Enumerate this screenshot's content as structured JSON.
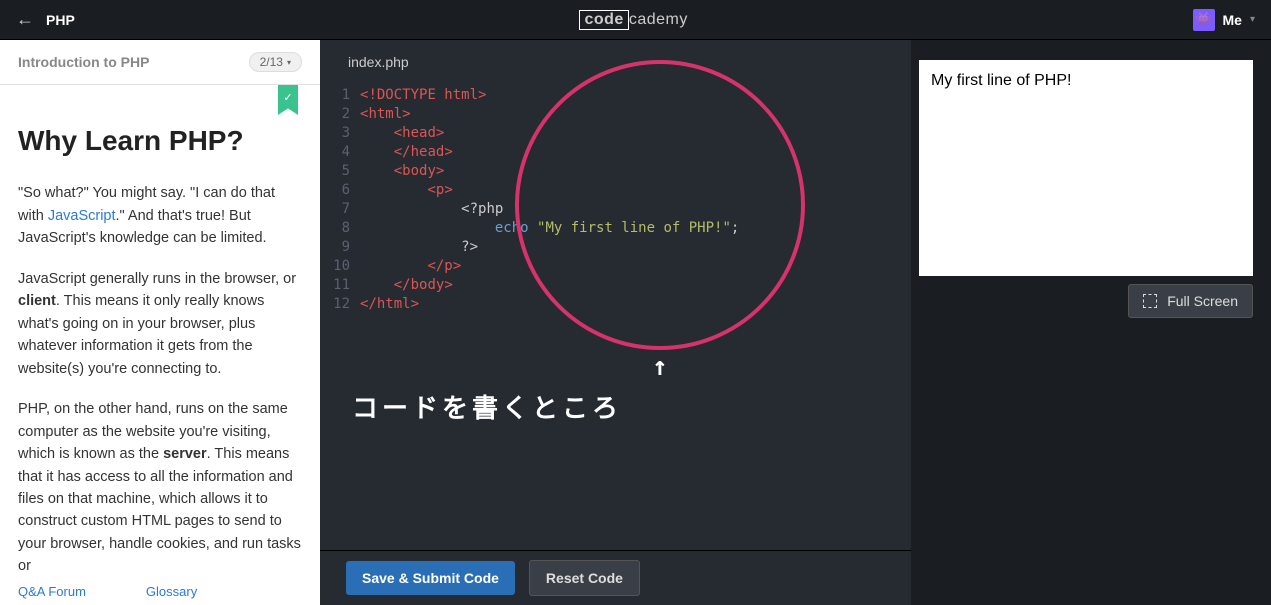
{
  "topbar": {
    "title": "PHP",
    "logo_boxed": "code",
    "logo_rest": "cademy",
    "me_label": "Me"
  },
  "sidebar": {
    "section_title": "Introduction to PHP",
    "progress": "2/13",
    "ribbon_check": "✓",
    "heading": "Why Learn PHP?",
    "para1_a": "\"So what?\" You might say. \"I can do that with ",
    "para1_link": "JavaScript",
    "para1_b": ".\" And that's true! But JavaScript's knowledge can be limited.",
    "para2_a": "JavaScript generally runs in the browser, or ",
    "para2_strong": "client",
    "para2_b": ". This means it only really knows what's going on in your browser, plus whatever information it gets from the website(s) you're connecting to.",
    "para3_a": "PHP, on the other hand, runs on the same computer as the website you're visiting, which is known as the ",
    "para3_strong": "server",
    "para3_b": ". This means that it has access to all the information and files on that machine, which allows it to construct custom HTML pages to send to your browser, handle cookies, and run tasks or",
    "footer_qa": "Q&A Forum",
    "footer_glossary": "Glossary"
  },
  "editor": {
    "tab_name": "index.php",
    "line_numbers": [
      "1",
      "2",
      "3",
      "4",
      "5",
      "6",
      "7",
      "8",
      "9",
      "10",
      "11",
      "12"
    ],
    "code": {
      "l1": "!DOCTYPE html",
      "l2": "html",
      "l3": "head",
      "l4": "/head",
      "l5": "body",
      "l6": "p",
      "l7": "<?php",
      "l8_kw": "echo",
      "l8_str": "\"My first line of PHP!\"",
      "l8_semi": ";",
      "l9": "?>",
      "l10": "/p",
      "l11": "/body",
      "l12": "/html"
    },
    "save_label": "Save & Submit Code",
    "reset_label": "Reset Code"
  },
  "annotation": {
    "arrow": "↑",
    "label": "コードを書くところ"
  },
  "output": {
    "text": "My first line of PHP!",
    "fullscreen_label": "Full Screen"
  }
}
